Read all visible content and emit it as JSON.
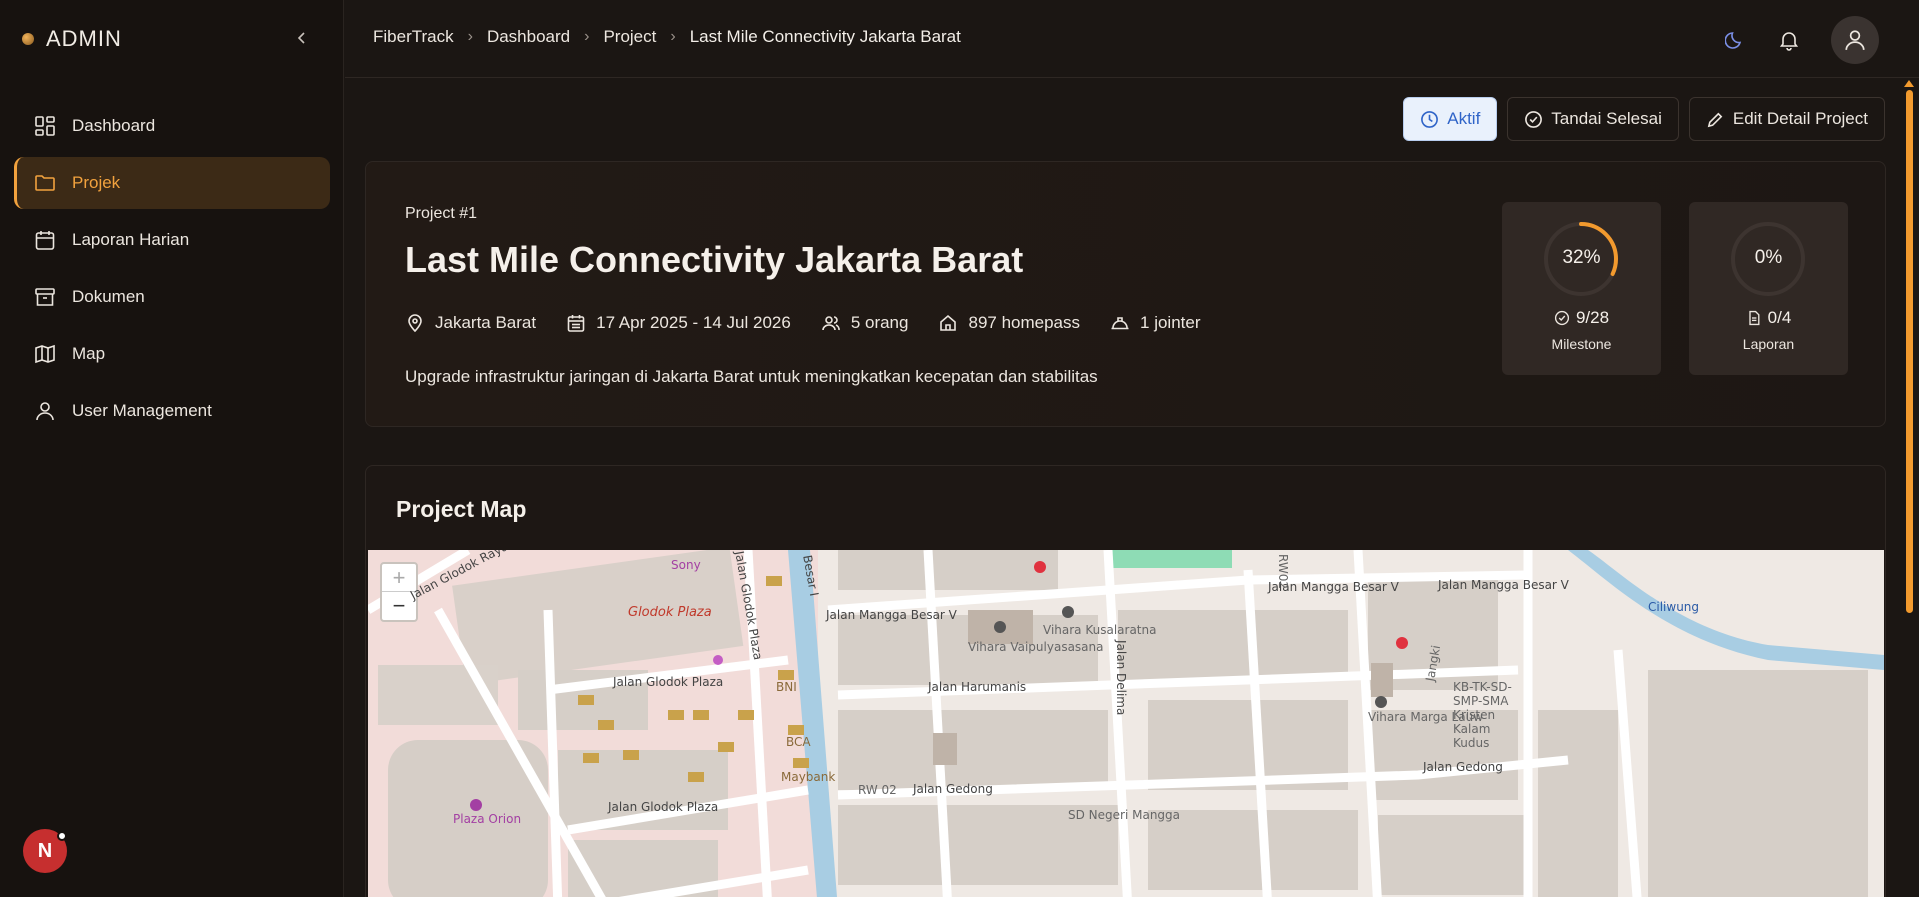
{
  "brand": {
    "name": "ADMIN"
  },
  "sidebar": {
    "items": [
      {
        "label": "Dashboard",
        "icon": "dashboard-icon"
      },
      {
        "label": "Projek",
        "icon": "folder-icon",
        "active": true
      },
      {
        "label": "Laporan Harian",
        "icon": "calendar-icon"
      },
      {
        "label": "Dokumen",
        "icon": "archive-icon"
      },
      {
        "label": "Map",
        "icon": "map-icon"
      },
      {
        "label": "User Management",
        "icon": "user-icon"
      }
    ],
    "bottom_avatar": "N"
  },
  "breadcrumb": [
    "FiberTrack",
    "Dashboard",
    "Project",
    "Last Mile Connectivity Jakarta Barat"
  ],
  "actions": {
    "status_label": "Aktif",
    "mark_done_label": "Tandai Selesai",
    "edit_label": "Edit Detail Project"
  },
  "project": {
    "number": "Project #1",
    "title": "Last Mile Connectivity Jakarta Barat",
    "location": "Jakarta Barat",
    "dates": "17 Apr 2025 - 14 Jul 2026",
    "team": "5 orang",
    "homepass": "897 homepass",
    "jointer": "1 jointer",
    "description": "Upgrade infrastruktur jaringan di Jakarta Barat untuk meningkatkan kecepatan dan stabilitas"
  },
  "stats": {
    "milestone": {
      "percent_label": "32%",
      "percent": 0.32,
      "count": "9/28",
      "label": "Milestone"
    },
    "laporan": {
      "percent_label": "0%",
      "percent": 0,
      "count": "0/4",
      "label": "Laporan"
    }
  },
  "map": {
    "title": "Project Map",
    "zoom_in": "+",
    "zoom_out": "−",
    "labels": [
      "Sony",
      "Glodok Plaza",
      "Jalan Glodok Plaza",
      "Jalan Glodok Raya",
      "Jalan Mangga Besar V",
      "Jalan Mangga Besar V",
      "Jalan Mangga Besar V",
      "Vihara Vaipulyasasana",
      "Vihara Kusalaratna",
      "Jalan Harumanis",
      "Jalan Delima",
      "Jalan Gedong",
      "Jalan Gedong",
      "Ciliwung",
      "Vihara Marga Lauw",
      "KB-TK-SD-SMP-SMA Kristen Kalam Kudus",
      "BNI",
      "BCA",
      "Maybank",
      "Plaza Orion",
      "SD Negeri Mangga",
      "RW 02",
      "RW02",
      "Jangki",
      "Besar I",
      "Jalan Glodok Plaza",
      "Jalan Glodok Plaza"
    ]
  },
  "colors": {
    "accent": "#f29a2e",
    "active_bg": "#3c2a16",
    "aktif_text": "#2f64c8"
  }
}
